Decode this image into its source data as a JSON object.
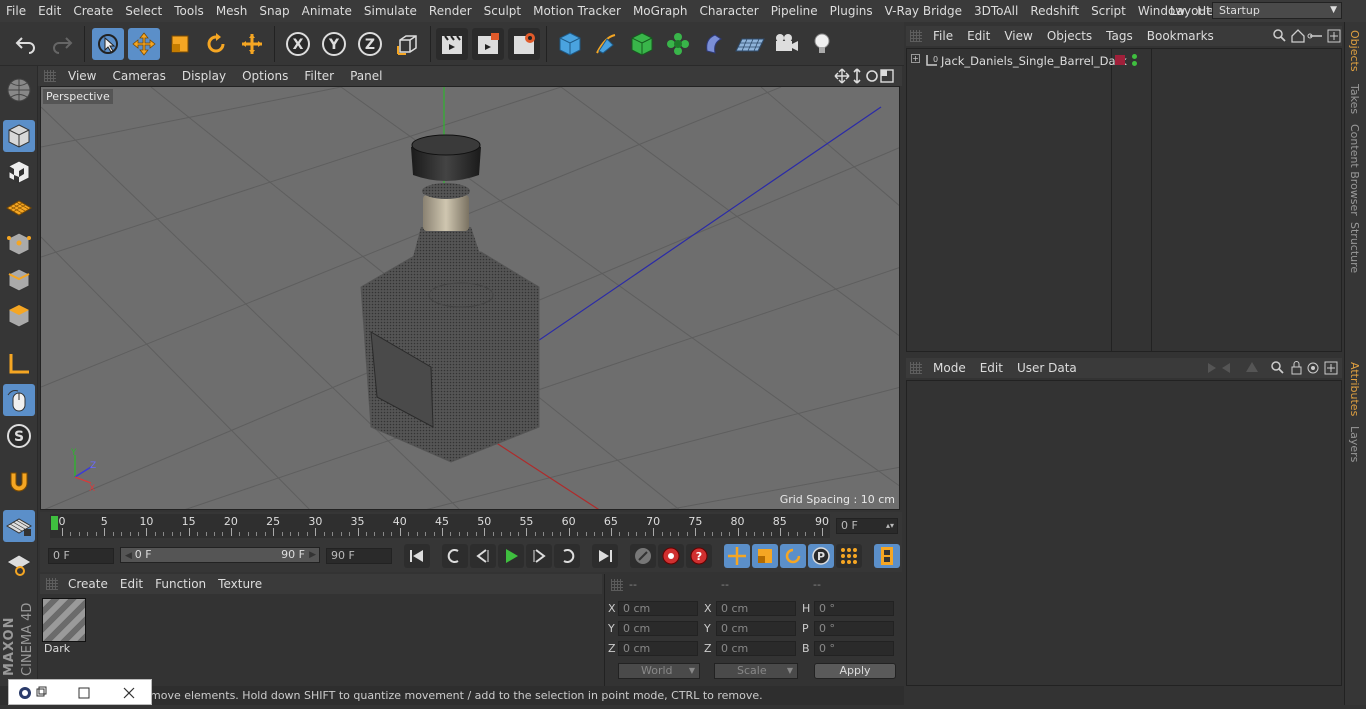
{
  "menubar": {
    "items": [
      "File",
      "Edit",
      "Create",
      "Select",
      "Tools",
      "Mesh",
      "Snap",
      "Animate",
      "Simulate",
      "Render",
      "Sculpt",
      "Motion Tracker",
      "MoGraph",
      "Character",
      "Pipeline",
      "Plugins",
      "V-Ray Bridge",
      "3DToAll",
      "Redshift",
      "Script",
      "Window",
      "Help"
    ],
    "layout_label": "Layout:",
    "layout_value": "Startup"
  },
  "viewport": {
    "menu": [
      "View",
      "Cameras",
      "Display",
      "Options",
      "Filter",
      "Panel"
    ],
    "label": "Perspective",
    "grid_spacing": "Grid Spacing : 10 cm",
    "axis_x": "X",
    "axis_y": "Y",
    "axis_z": "Z"
  },
  "timeline": {
    "ticks": [
      "0",
      "5",
      "10",
      "15",
      "20",
      "25",
      "30",
      "35",
      "40",
      "45",
      "50",
      "55",
      "60",
      "65",
      "70",
      "75",
      "80",
      "85",
      "90"
    ],
    "current_frame": "0 F"
  },
  "playback": {
    "start": "0 F",
    "range_start": "0 F",
    "range_end": "90 F",
    "end": "90 F"
  },
  "material": {
    "menu": [
      "Create",
      "Edit",
      "Function",
      "Texture"
    ],
    "name": "Dark"
  },
  "coordinates": {
    "headers": [
      "--",
      "--",
      "--"
    ],
    "rows": [
      {
        "l1": "X",
        "v1": "0 cm",
        "l2": "X",
        "v2": "0 cm",
        "l3": "H",
        "v3": "0 °"
      },
      {
        "l1": "Y",
        "v1": "0 cm",
        "l2": "Y",
        "v2": "0 cm",
        "l3": "P",
        "v3": "0 °"
      },
      {
        "l1": "Z",
        "v1": "0 cm",
        "l2": "Z",
        "v2": "0 cm",
        "l3": "B",
        "v3": "0 °"
      }
    ],
    "world": "World",
    "scale": "Scale",
    "apply": "Apply"
  },
  "objects": {
    "menu": [
      "File",
      "Edit",
      "View",
      "Objects",
      "Tags",
      "Bookmarks"
    ],
    "items": [
      {
        "name": "Jack_Daniels_Single_Barrel_Dark"
      }
    ]
  },
  "attributes": {
    "menu": [
      "Mode",
      "Edit",
      "User Data"
    ]
  },
  "right_tabs": [
    "Objects",
    "Takes",
    "Content Browser",
    "Structure",
    "Attributes",
    "Layers"
  ],
  "status": "move elements. Hold down SHIFT to quantize movement / add to the selection in point mode, CTRL to remove.",
  "branding": {
    "maxon": "MAXON",
    "cinema": "CINEMA 4D"
  },
  "colors": {
    "accent_blue": "#5b8fc9",
    "tab_active": "#e0a040",
    "play_green": "#3fbf3f"
  }
}
